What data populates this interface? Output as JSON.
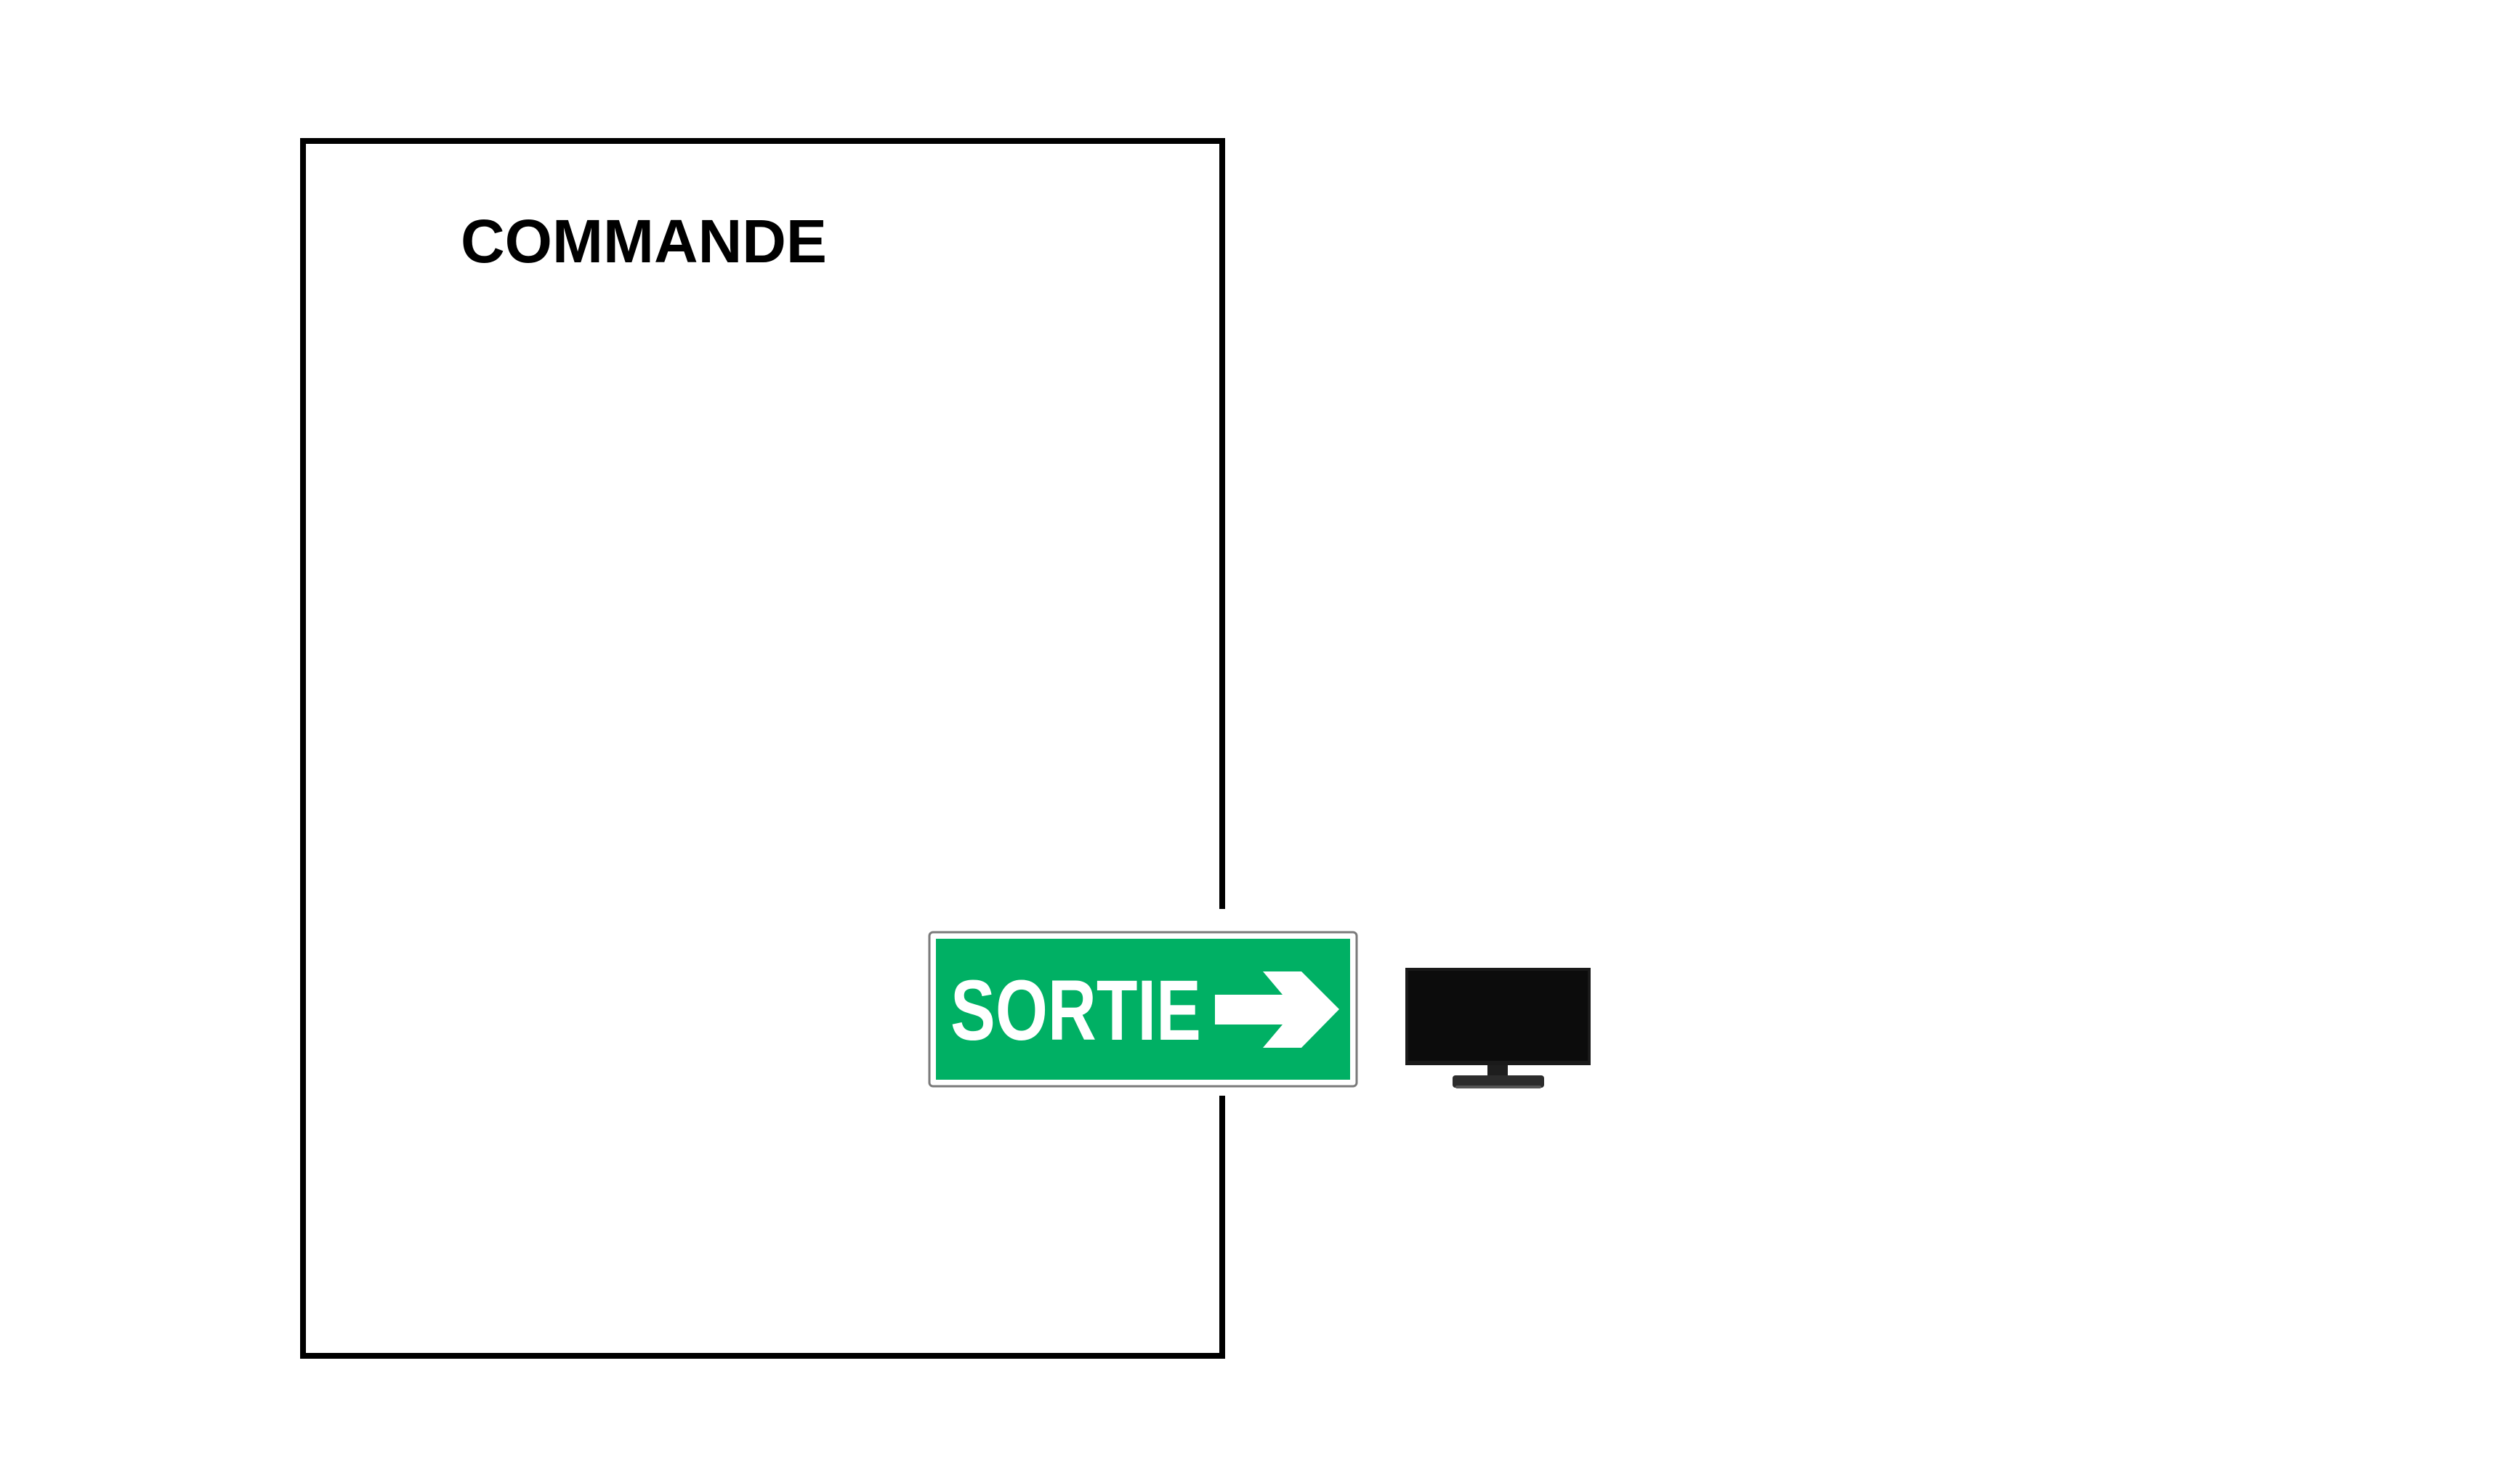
{
  "room": {
    "title": "COMMANDE"
  },
  "exit_sign": {
    "label": "SORTIE",
    "arrow_icon": "arrow-right-icon",
    "background_color": "#00b064",
    "text_color": "#ffffff"
  },
  "monitor": {
    "icon": "monitor-icon",
    "screen_color": "#0c0c0c"
  },
  "colors": {
    "wall": "#000000",
    "background": "#ffffff"
  }
}
